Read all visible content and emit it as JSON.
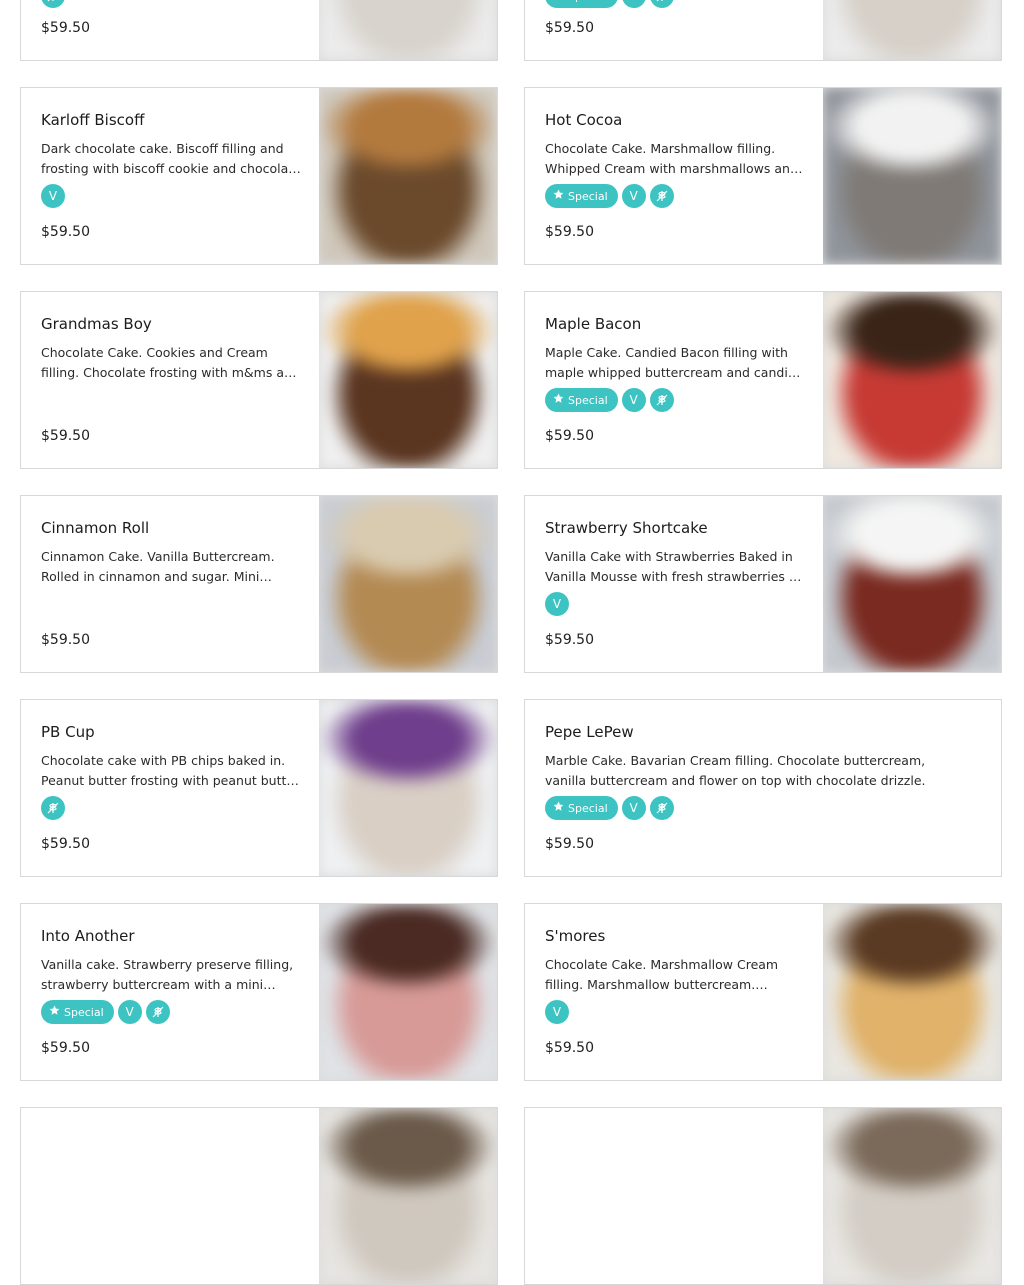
{
  "top_partial": [
    {
      "price": "$59.50",
      "tags": [
        "wheat"
      ]
    },
    {
      "price": "$59.50",
      "tags": [
        "special",
        "vegetarian",
        "wheat"
      ]
    }
  ],
  "items": [
    {
      "name": "Karloff Biscoff",
      "description": "Dark chocolate cake. Biscoff filling and frosting with biscoff cookie and chocolate drizzle.",
      "price": "$59.50",
      "tags": [
        "vegetarian"
      ]
    },
    {
      "name": "Hot Cocoa",
      "description": "Chocolate Cake. Marshmallow filling. Whipped Cream with marshmallows and chocolate drizzle.",
      "price": "$59.50",
      "tags": [
        "special",
        "vegetarian",
        "wheat"
      ]
    },
    {
      "name": "Grandmas Boy",
      "description": "Chocolate Cake. Cookies and Cream filling. Chocolate frosting with m&ms and cookies on top.",
      "price": "$59.50",
      "tags": []
    },
    {
      "name": "Maple Bacon",
      "description": "Maple Cake. Candied Bacon filling with maple whipped buttercream and candied bacon.",
      "price": "$59.50",
      "tags": [
        "special",
        "vegetarian",
        "wheat"
      ]
    },
    {
      "name": "Cinnamon Roll",
      "description": "Cinnamon Cake. Vanilla Buttercream. Rolled in cinnamon and sugar. Mini cinnamon rolls on top.",
      "price": "$59.50",
      "tags": []
    },
    {
      "name": "Strawberry Shortcake",
      "description": "Vanilla Cake with Strawberries Baked in Vanilla Mousse with fresh strawberries on top.",
      "price": "$59.50",
      "tags": [
        "vegetarian"
      ]
    },
    {
      "name": "PB Cup",
      "description": "Chocolate cake with PB chips baked in. Peanut butter frosting with peanut butter cups.",
      "price": "$59.50",
      "tags": [
        "wheat"
      ]
    },
    {
      "name": "Pepe LePew",
      "description": "Marble Cake. Bavarian Cream filling. Chocolate buttercream, vanilla buttercream and flower on top with chocolate drizzle.",
      "price": "$59.50",
      "tags": [
        "special",
        "vegetarian",
        "wheat"
      ]
    },
    {
      "name": "Into Another",
      "description": "Vanilla cake. Strawberry preserve filling, strawberry buttercream with a mini strawberry cake on top.",
      "price": "$59.50",
      "tags": [
        "special",
        "vegetarian",
        "wheat"
      ]
    },
    {
      "name": "S'mores",
      "description": "Chocolate Cake. Marshmallow Cream filling. Marshmallow buttercream. Graham cracker crumble.",
      "price": "$59.50",
      "tags": [
        "vegetarian"
      ]
    }
  ],
  "labels": {
    "special": "Special",
    "vegetarian": "V"
  },
  "colors": {
    "accent": "#3cc3c2",
    "border": "#d8d8d8",
    "text": "#1f1f1f"
  }
}
